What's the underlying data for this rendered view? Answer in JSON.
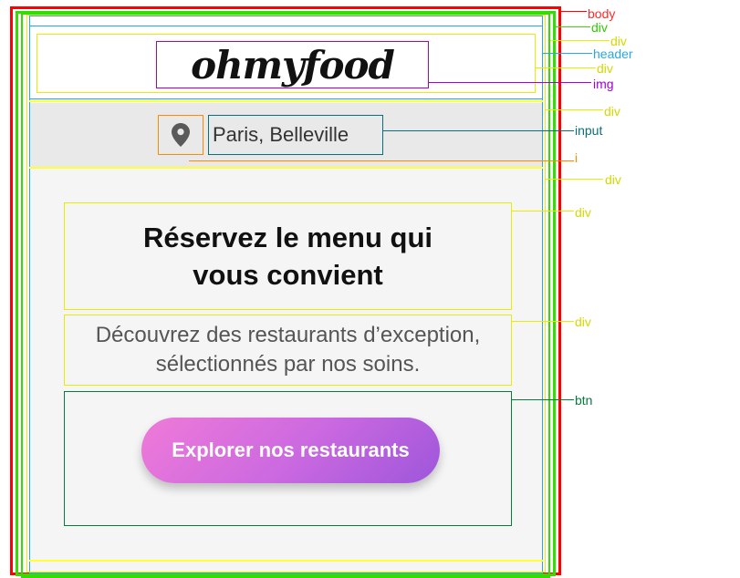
{
  "header": {
    "logo_text": "ohmyfood"
  },
  "location": {
    "pin_icon": "map-pin-icon",
    "value": "Paris, Belleville"
  },
  "hero": {
    "title": "Réservez le menu qui vous convient",
    "subtitle": "Découvrez des restaurants d’exception, sélectionnés par nos soins.",
    "cta_label": "Explorer nos restaurants"
  },
  "inspector_labels": {
    "body": "body",
    "div1": "div",
    "div2": "div",
    "header": "header",
    "div3": "div",
    "img": "img",
    "div4": "div",
    "input": "input",
    "i": "i",
    "div5": "div",
    "div6": "div",
    "div7": "div",
    "btn": "btn"
  },
  "colors": {
    "body": "#ff0000",
    "div_green": "#33dd00",
    "div_yellow": "#ffff33",
    "header": "#2aa7e0",
    "img": "#a100d6",
    "input": "#0a6f7d",
    "i": "#ff8a00",
    "btn": "#077a3d",
    "cta_gradient_start": "#ef7ad8",
    "cta_gradient_end": "#9e56db"
  }
}
